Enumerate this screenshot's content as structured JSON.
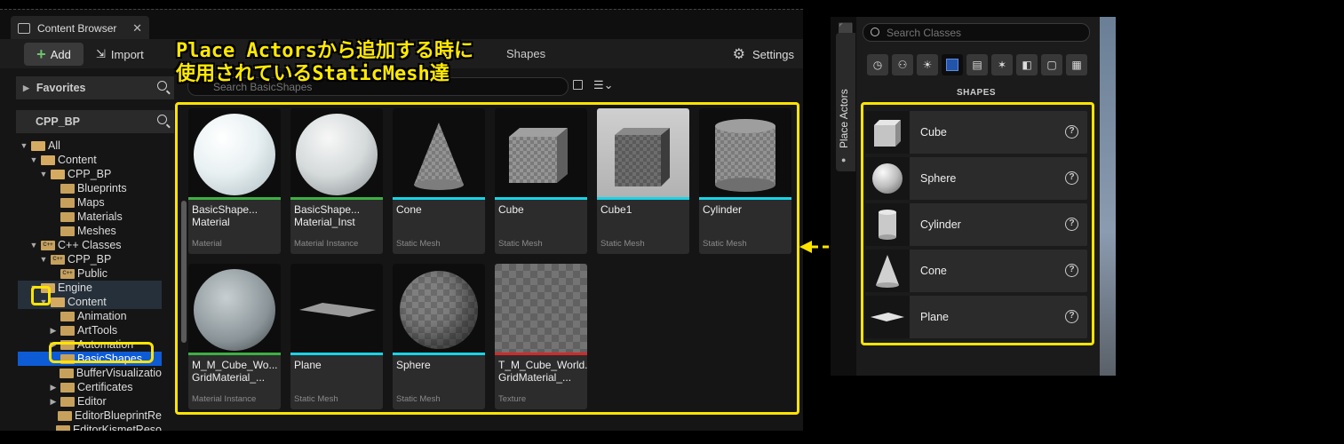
{
  "content_browser": {
    "tab_title": "Content Browser",
    "toolbar": {
      "add_label": "Add",
      "import_label": "Import",
      "settings_label": "Settings",
      "breadcrumb_tail": "Shapes"
    },
    "search_placeholder": "Search BasicShapes",
    "favorites_label": "Favorites",
    "project_label": "CPP_BP",
    "tree": [
      {
        "label": "All",
        "depth": 0,
        "arrow": "▼",
        "open": true
      },
      {
        "label": "Content",
        "depth": 1,
        "arrow": "▼",
        "open": true
      },
      {
        "label": "CPP_BP",
        "depth": 2,
        "arrow": "▼",
        "open": true
      },
      {
        "label": "Blueprints",
        "depth": 3,
        "arrow": ""
      },
      {
        "label": "Maps",
        "depth": 3,
        "arrow": ""
      },
      {
        "label": "Materials",
        "depth": 3,
        "arrow": ""
      },
      {
        "label": "Meshes",
        "depth": 3,
        "arrow": ""
      },
      {
        "label": "C++ Classes",
        "depth": 1,
        "arrow": "▼",
        "cpp": true
      },
      {
        "label": "CPP_BP",
        "depth": 2,
        "arrow": "▼",
        "cpp": true
      },
      {
        "label": "Public",
        "depth": 3,
        "arrow": "",
        "cpp": true
      },
      {
        "label": "Engine",
        "depth": 1,
        "arrow": "▼",
        "open": true,
        "hl": true
      },
      {
        "label": "Content",
        "depth": 2,
        "arrow": "▼",
        "open": true,
        "hl": true
      },
      {
        "label": "Animation",
        "depth": 3,
        "arrow": ""
      },
      {
        "label": "ArtTools",
        "depth": 3,
        "arrow": "▶"
      },
      {
        "label": "Automation",
        "depth": 3,
        "arrow": "▶"
      },
      {
        "label": "BasicShapes",
        "depth": 3,
        "arrow": "",
        "sel": true
      },
      {
        "label": "BufferVisualizatio",
        "depth": 3,
        "arrow": ""
      },
      {
        "label": "Certificates",
        "depth": 3,
        "arrow": "▶"
      },
      {
        "label": "Editor",
        "depth": 3,
        "arrow": "▶"
      },
      {
        "label": "EditorBlueprintRe",
        "depth": 3,
        "arrow": ""
      },
      {
        "label": "EditorKismetReso",
        "depth": 3,
        "arrow": ""
      }
    ],
    "assets": [
      {
        "name": "BasicShape... Material",
        "type": "Material",
        "strip": "#3cb043",
        "kind": "sphere-white"
      },
      {
        "name": "BasicShape... Material_Inst",
        "type": "Material Instance",
        "strip": "#3cb043",
        "kind": "sphere-light"
      },
      {
        "name": "Cone",
        "type": "Static Mesh",
        "strip": "#19d3e6",
        "kind": "cone"
      },
      {
        "name": "Cube",
        "type": "Static Mesh",
        "strip": "#19d3e6",
        "kind": "cube"
      },
      {
        "name": "Cube1",
        "type": "Static Mesh",
        "strip": "#19d3e6",
        "kind": "cube-scene"
      },
      {
        "name": "Cylinder",
        "type": "Static Mesh",
        "strip": "#19d3e6",
        "kind": "cylinder"
      },
      {
        "name": "M_M_Cube_Wo... GridMaterial_...",
        "type": "Material Instance",
        "strip": "#3cb043",
        "kind": "sphere-grid"
      },
      {
        "name": "Plane",
        "type": "Static Mesh",
        "strip": "#19d3e6",
        "kind": "plane"
      },
      {
        "name": "Sphere",
        "type": "Static Mesh",
        "strip": "#19d3e6",
        "kind": "sphere-check"
      },
      {
        "name": "T_M_Cube_World... GridMaterial_...",
        "type": "Texture",
        "strip": "#d02a2a",
        "kind": "texture"
      }
    ]
  },
  "annotation": {
    "text": "Place Actorsから追加する時に\n使用されているStaticMesh達",
    "color": "#ffe400"
  },
  "place_actors": {
    "tab_label": "Place Actors",
    "search_placeholder": "Search Classes",
    "categories": [
      "recent-icon",
      "basic-icon",
      "lights-icon",
      "shapes-icon",
      "cinematic-icon",
      "visual-effects-icon",
      "volumes-icon",
      "all-classes-icon",
      "geometry-icon"
    ],
    "section_title": "SHAPES",
    "shapes": [
      {
        "label": "Cube",
        "kind": "cube"
      },
      {
        "label": "Sphere",
        "kind": "sphere"
      },
      {
        "label": "Cylinder",
        "kind": "cylinder"
      },
      {
        "label": "Cone",
        "kind": "cone"
      },
      {
        "label": "Plane",
        "kind": "plane"
      }
    ]
  }
}
